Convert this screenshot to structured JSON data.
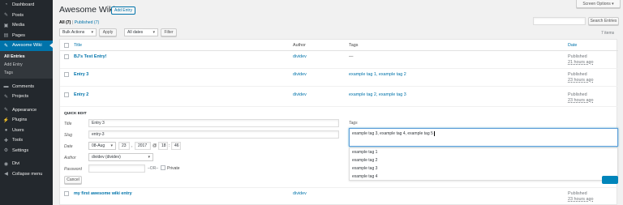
{
  "sidebar": {
    "items": [
      {
        "label": "Dashboard",
        "icon": "dashboard-icon",
        "glyph": "◔"
      },
      {
        "label": "Posts",
        "icon": "pin-icon",
        "glyph": "✎"
      },
      {
        "label": "Media",
        "icon": "media-icon",
        "glyph": "▣"
      },
      {
        "label": "Pages",
        "icon": "pages-icon",
        "glyph": "▤"
      },
      {
        "label": "Awesome Wiki",
        "icon": "wiki-icon",
        "glyph": "✎"
      }
    ],
    "sub": [
      "All Entries",
      "Add Entry",
      "Tags"
    ],
    "items2": [
      {
        "label": "Comments",
        "icon": "comments-icon",
        "glyph": "▬"
      },
      {
        "label": "Projects",
        "icon": "projects-icon",
        "glyph": "✎"
      }
    ],
    "items3": [
      {
        "label": "Appearance",
        "icon": "appearance-icon",
        "glyph": "✎"
      },
      {
        "label": "Plugins",
        "icon": "plugins-icon",
        "glyph": "⚡"
      },
      {
        "label": "Users",
        "icon": "users-icon",
        "glyph": "●"
      },
      {
        "label": "Tools",
        "icon": "tools-icon",
        "glyph": "✚"
      },
      {
        "label": "Settings",
        "icon": "settings-icon",
        "glyph": "⚙"
      }
    ],
    "items4": [
      {
        "label": "Divi",
        "icon": "divi-icon",
        "glyph": "◉"
      },
      {
        "label": "Collapse menu",
        "icon": "collapse-icon",
        "glyph": "◀"
      }
    ]
  },
  "header": {
    "title": "Awesome Wiki",
    "add_entry": "Add Entry",
    "screen_options": "Screen Options ▾"
  },
  "filters": {
    "all": "All (7)",
    "separator": "|",
    "published": "Published (7)",
    "bulk_actions": "Bulk Actions",
    "apply": "Apply",
    "all_dates": "All dates",
    "filter": "Filter",
    "search_button": "Search Entries",
    "items_count": "7 items"
  },
  "table": {
    "headers": {
      "title": "Title",
      "author": "Author",
      "tags": "Tags",
      "date": "Date"
    },
    "rows": [
      {
        "title": "BJ's Test Entry!",
        "author": "dividev",
        "tags": "—",
        "status": "Published",
        "time": "21 hours ago"
      },
      {
        "title": "Entry 3",
        "author": "dividev",
        "tags": "example tag 1, example tag 2",
        "status": "Published",
        "time": "23 hours ago"
      },
      {
        "title": "Entry 2",
        "author": "dividev",
        "tags": "example tag 2, example tag 3",
        "status": "Published",
        "time": "23 hours ago"
      },
      {
        "title": "my first awesome wiki entry",
        "author": "dividev",
        "tags": "",
        "status": "Published",
        "time": "23 hours ago"
      }
    ]
  },
  "quick_edit": {
    "heading": "QUICK EDIT",
    "title_label": "Title",
    "title_value": "Entry 3",
    "slug_label": "Slug",
    "slug_value": "entry-3",
    "date_label": "Date",
    "month": "08-Aug",
    "day": "23",
    "year": "2017",
    "at": "@",
    "hour": "18",
    "colon": ":",
    "minute": "46",
    "author_label": "Author",
    "author_value": "dividev (dividev)",
    "password_label": "Password",
    "or": "–OR–",
    "private": "Private",
    "tags_label": "Tags",
    "tags_value": "example tag 3, example tag 4, example tag 5",
    "cancel": "Cancel",
    "suggestions": [
      "example tag 1",
      "example tag 2",
      "example tag 3",
      "example tag 4"
    ]
  }
}
